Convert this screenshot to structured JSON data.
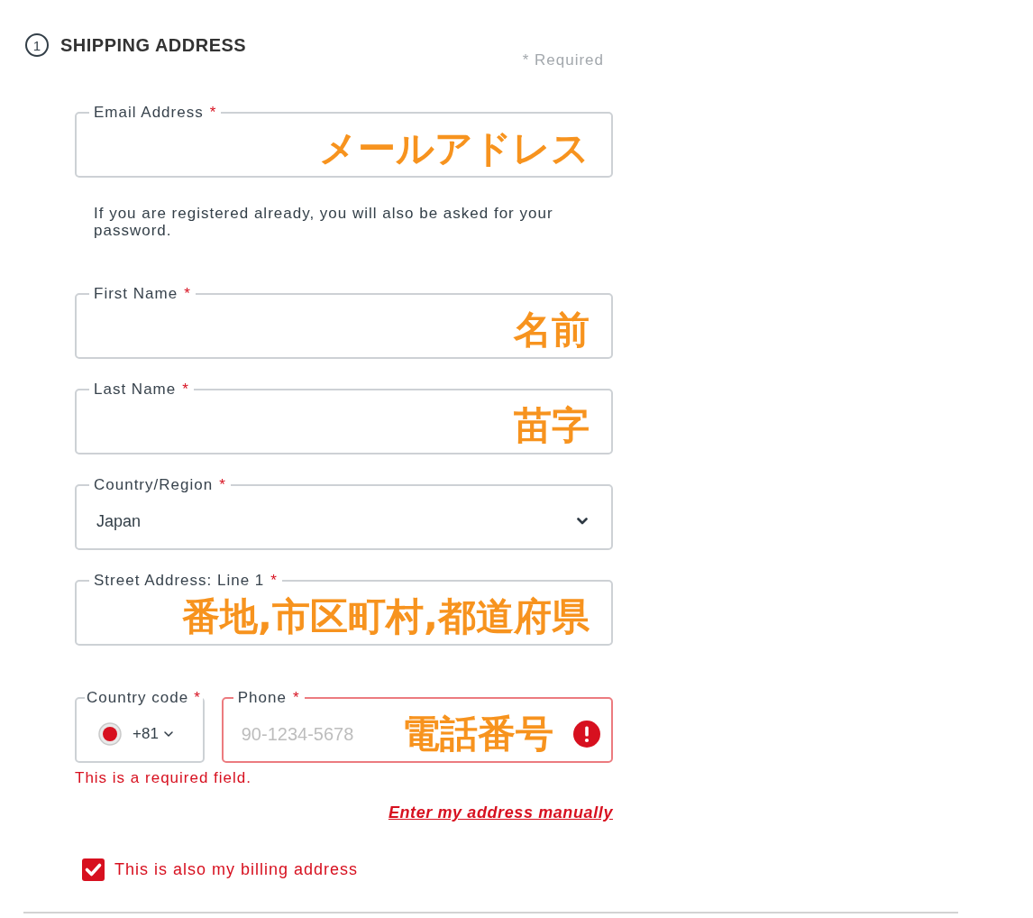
{
  "section": {
    "step": "1",
    "title": "SHIPPING ADDRESS",
    "required_note": "* Required"
  },
  "fields": [
    {
      "kind": "text",
      "label": "Email Address",
      "required_mark": "*",
      "annotation": "メールアドレス",
      "invalid": false,
      "hint": "If you are registered already, you will also be asked for your password."
    },
    {
      "kind": "text",
      "label": "First Name",
      "required_mark": "*",
      "annotation": "名前",
      "invalid": false
    },
    {
      "kind": "text",
      "label": "Last Name",
      "required_mark": "*",
      "annotation": "苗字",
      "invalid": false
    },
    {
      "kind": "select",
      "label": "Country/Region",
      "required_mark": "*",
      "value": "Japan",
      "invalid": false
    },
    {
      "kind": "text",
      "label": "Street Address: Line 1",
      "required_mark": "*",
      "annotation": "番地,市区町村,都道府県",
      "invalid": false
    },
    {
      "kind": "phone",
      "country_code": {
        "label": "Country code",
        "required_mark": "*",
        "value": "+81"
      },
      "phone": {
        "label": "Phone",
        "required_mark": "*",
        "placeholder": "90-1234-5678",
        "annotation": "電話番号",
        "invalid": true,
        "error": "This is a required field."
      }
    }
  ],
  "manual_link": "Enter my address manually",
  "billing_checkbox": {
    "label": "This is also my billing address",
    "checked": true
  }
}
